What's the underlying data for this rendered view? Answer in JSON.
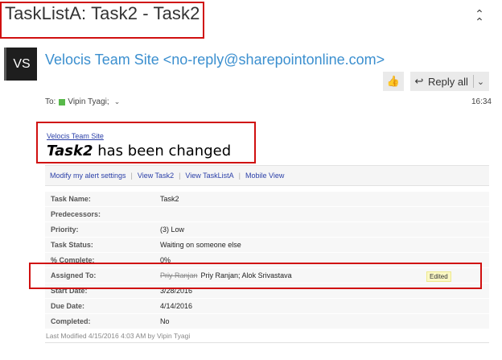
{
  "subject": "TaskListA: Task2 - Task2",
  "sender": {
    "initials": "VS",
    "display": "Velocis Team Site <no-reply@sharepointonline.com>"
  },
  "actions": {
    "reply_all_label": "Reply all"
  },
  "to": {
    "label": "To:",
    "recipient": "Vipin Tyagi;"
  },
  "time": "16:34",
  "body": {
    "site_link": "Velocis Team Site",
    "task_name": "Task2",
    "changed_text": "has been changed",
    "links": [
      "Modify my alert settings",
      "View Task2",
      "View TaskListA",
      "Mobile View"
    ],
    "rows": [
      {
        "label": "Task Name:",
        "value": "Task2"
      },
      {
        "label": "Predecessors:",
        "value": ""
      },
      {
        "label": "Priority:",
        "value": "(3) Low"
      },
      {
        "label": "Task Status:",
        "value": "Waiting on someone else"
      },
      {
        "label": "% Complete:",
        "value": "0%"
      },
      {
        "label": "Assigned To:",
        "old_value": "Priy Ranjan",
        "value": "Priy Ranjan; Alok Srivastava",
        "badge": "Edited"
      },
      {
        "label": "Start Date:",
        "value": "3/28/2016"
      },
      {
        "label": "Due Date:",
        "value": "4/14/2016"
      },
      {
        "label": "Completed:",
        "value": "No"
      }
    ],
    "last_modified": "Last Modified 4/15/2016 4:03 AM by Vipin Tyagi"
  },
  "colors": {
    "highlight_border": "#d01010",
    "sender_link": "#3b8fcf",
    "body_link": "#2a3fa8",
    "presence": "#58b94a"
  }
}
